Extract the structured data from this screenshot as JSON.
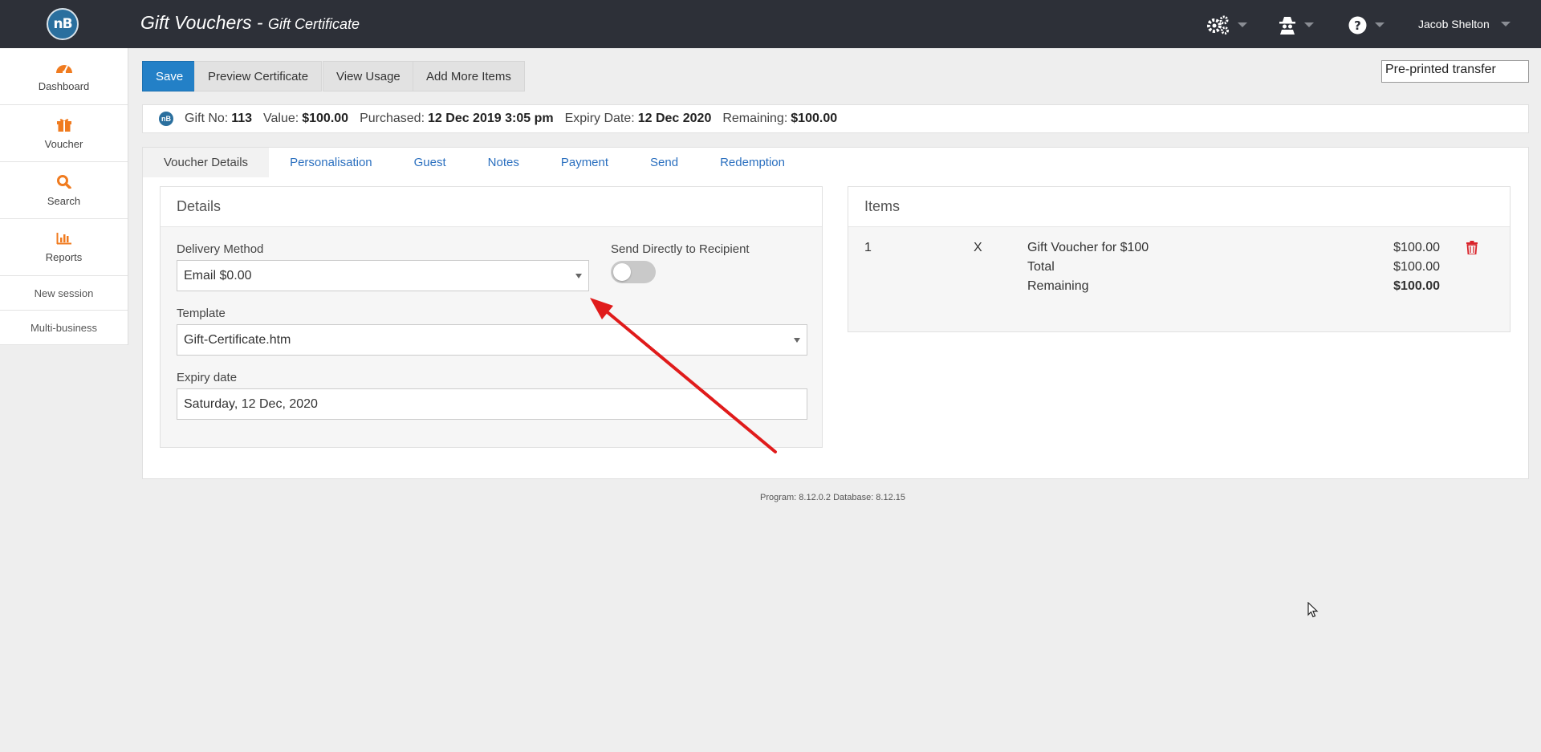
{
  "header": {
    "logo_text": "nB",
    "title": "Gift Vouchers",
    "separator": " - ",
    "subtitle": "Gift Certificate",
    "icons": [
      "gears-icon",
      "spy-icon",
      "help-icon"
    ],
    "user_name": "Jacob Shelton"
  },
  "sidebar": {
    "items": [
      {
        "label": "Dashboard",
        "icon": "dashboard-icon"
      },
      {
        "label": "Voucher",
        "icon": "gift-icon"
      },
      {
        "label": "Search",
        "icon": "search-icon"
      },
      {
        "label": "Reports",
        "icon": "bar-chart-icon"
      }
    ],
    "links": [
      "New session",
      "Multi-business"
    ]
  },
  "toolbar": {
    "save_label": "Save",
    "preview_label": "Preview Certificate",
    "usage_label": "View Usage",
    "add_items_label": "Add More Items",
    "pre_printed": "Pre-printed transfer"
  },
  "info": {
    "gift_no_label": "Gift No:",
    "gift_no": "113",
    "value_label": "Value:",
    "value": "$100.00",
    "purchased_label": "Purchased:",
    "purchased": "12 Dec 2019 3:05 pm",
    "expiry_label": "Expiry Date:",
    "expiry": "12 Dec 2020",
    "remaining_label": "Remaining:",
    "remaining": "$100.00"
  },
  "tabs": [
    "Voucher Details",
    "Personalisation",
    "Guest",
    "Notes",
    "Payment",
    "Send",
    "Redemption"
  ],
  "details": {
    "heading": "Details",
    "delivery_label": "Delivery Method",
    "delivery_value": "Email $0.00",
    "send_direct_label": "Send Directly to Recipient",
    "send_direct_on": false,
    "template_label": "Template",
    "template_value": "Gift-Certificate.htm",
    "expiry_label": "Expiry date",
    "expiry_value": "Saturday, 12 Dec, 2020"
  },
  "items": {
    "heading": "Items",
    "row": {
      "qty": "1",
      "x": "X",
      "desc": "Gift Voucher for $100",
      "amount": "$100.00"
    },
    "total_label": "Total",
    "total": "$100.00",
    "remaining_label": "Remaining",
    "remaining": "$100.00"
  },
  "footer": {
    "version": "Program: 8.12.0.2 Database: 8.12.15"
  },
  "colors": {
    "topbar": "#2d3038",
    "accent": "#f07b1f",
    "primary": "#2380c7",
    "link": "#2a6fbf",
    "annotation": "#e01b1b",
    "delete": "#d9232a"
  }
}
